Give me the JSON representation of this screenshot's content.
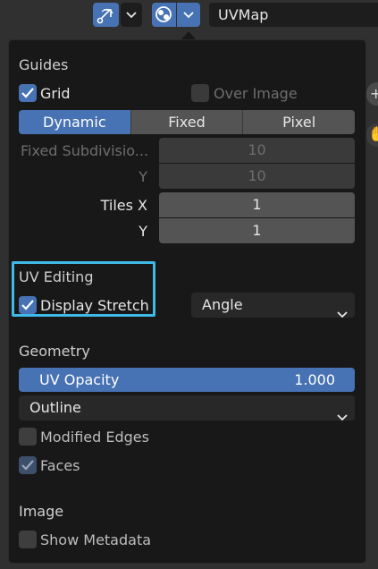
{
  "header": {
    "uv_map_value": "UVMap",
    "icons": [
      "uv-sync-select-icon",
      "chevron-down-icon",
      "overlay-icon",
      "chevron-down-icon"
    ]
  },
  "guides": {
    "heading": "Guides",
    "grid_label": "Grid",
    "grid_checked": true,
    "over_image_label": "Over Image",
    "over_image_checked": false,
    "modes": [
      "Dynamic",
      "Fixed",
      "Pixel"
    ],
    "active_mode": "Dynamic",
    "fixed_subdivisions_label": "Fixed Subdivisio...",
    "fixed_subdivisions_x": "10",
    "y_label": "Y",
    "fixed_subdivisions_y": "10",
    "tiles_x_label": "Tiles X",
    "tiles_x": "1",
    "tiles_y_label": "Y",
    "tiles_y": "1"
  },
  "uv_editing": {
    "heading": "UV Editing",
    "display_stretch_label": "Display Stretch",
    "display_stretch_checked": true,
    "stretch_mode": "Angle"
  },
  "geometry": {
    "heading": "Geometry",
    "uv_opacity_label": "UV Opacity",
    "uv_opacity_value": "1.000",
    "edge_display": "Outline",
    "modified_edges_label": "Modified Edges",
    "modified_edges_checked": false,
    "faces_label": "Faces",
    "faces_checked": true
  },
  "image": {
    "heading": "Image",
    "show_metadata_label": "Show Metadata",
    "show_metadata_checked": false
  },
  "colors": {
    "accent": "#4772b3",
    "highlight": "#3fb9e8",
    "panel_bg": "#181818"
  }
}
